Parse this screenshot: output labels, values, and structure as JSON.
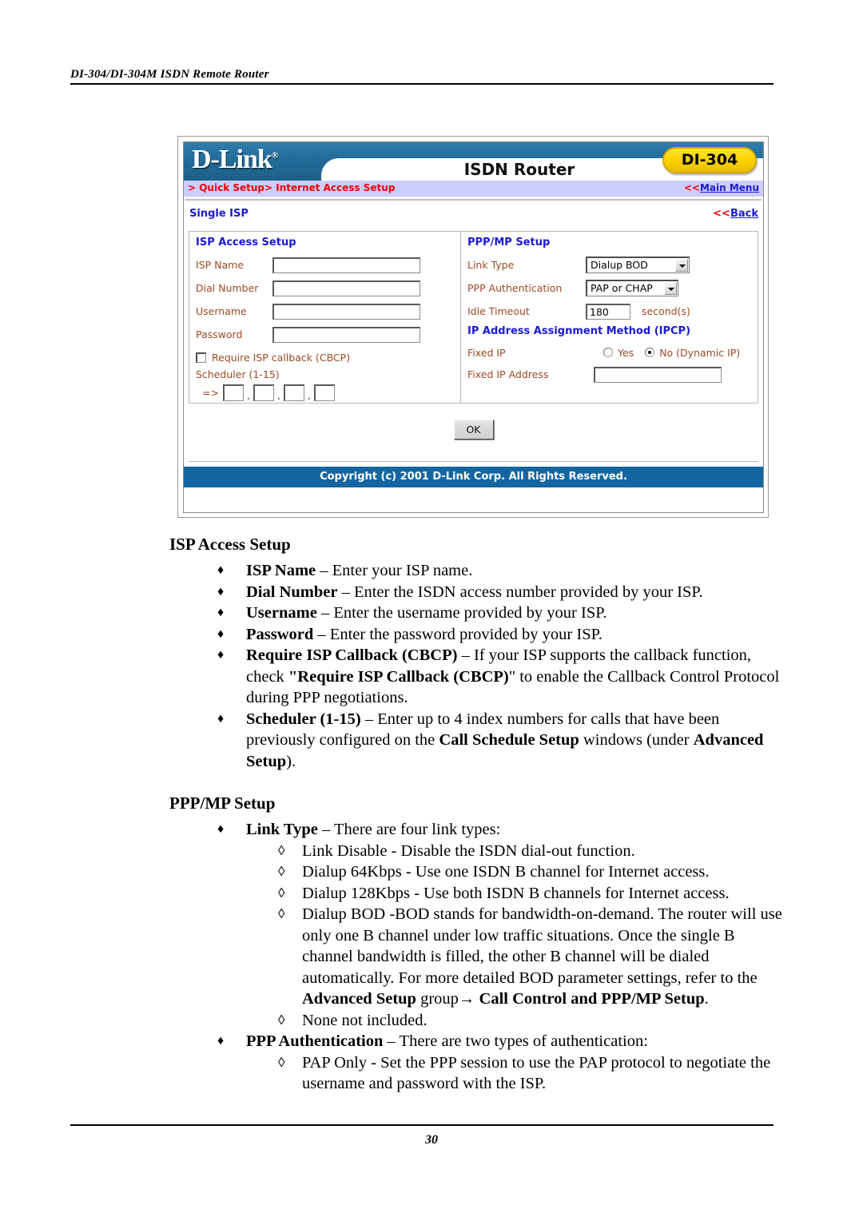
{
  "document": {
    "running_head": "DI-304/DI-304M ISDN Remote Router",
    "page_number": "30"
  },
  "router_ui": {
    "brand": {
      "logo_text": "D-Link",
      "logo_trademark": "®",
      "title": "ISDN Router",
      "model_badge": "DI-304"
    },
    "breadcrumb": {
      "path": "> Quick Setup> Internet Access Setup",
      "main_menu_arrows": "<<",
      "main_menu_label": "Main Menu"
    },
    "subheader": {
      "title": "Single ISP",
      "back_arrows": "<<",
      "back_label": "Back"
    },
    "isp_access_setup": {
      "group_title": "ISP Access Setup",
      "fields": [
        {
          "label": "ISP Name",
          "value": ""
        },
        {
          "label": "Dial Number",
          "value": ""
        },
        {
          "label": "Username",
          "value": ""
        },
        {
          "label": "Password",
          "value": ""
        }
      ],
      "callback_checkbox": {
        "label": "Require ISP callback (CBCP)",
        "checked": false
      },
      "scheduler": {
        "label": "Scheduler (1-15)",
        "arrow": "=>",
        "separator": ",",
        "values": [
          "",
          "",
          "",
          ""
        ]
      }
    },
    "ppp_mp_setup": {
      "group_title": "PPP/MP Setup",
      "link_type": {
        "label": "Link Type",
        "value": "Dialup BOD",
        "options": [
          "Link Disable",
          "Dialup 64Kbps",
          "Dialup 128Kbps",
          "Dialup BOD"
        ]
      },
      "ppp_authentication": {
        "label": "PPP Authentication",
        "value": "PAP or CHAP",
        "options": [
          "PAP Only",
          "PAP or CHAP"
        ]
      },
      "idle_timeout": {
        "label": "Idle Timeout",
        "value": "180",
        "units": "second(s)"
      },
      "ipcp": {
        "group_title": "IP Address Assignment Method (IPCP)",
        "fixed_ip": {
          "label": "Fixed IP",
          "yes_label": "Yes",
          "no_label": "No (Dynamic IP)",
          "selected": "No (Dynamic IP)"
        },
        "fixed_ip_address": {
          "label": "Fixed IP Address",
          "value": ""
        }
      }
    },
    "ok_button": "OK",
    "copyright": "Copyright (c) 2001 D-Link Corp. All Rights Reserved."
  },
  "body": {
    "section1_title": "ISP Access Setup",
    "section2_title": "PPP/MP Setup",
    "bullet_char": "♦",
    "diamond_char": "◊",
    "isp_bullets": {
      "b1_term": "ISP Name",
      "b1_text": " – Enter your ISP name.",
      "b2_term": "Dial Number",
      "b2_text": " – Enter the ISDN access number provided by your ISP.",
      "b3_term": "Username",
      "b3_text": " – Enter the username provided by your ISP.",
      "b4_term": "Password",
      "b4_text": " – Enter the password provided by your ISP.",
      "b5_term": "Require ISP Callback (CBCP)",
      "b5_text_a": " – If your ISP supports the callback function, check ",
      "b5_quoted": "\"Require ISP Callback (CBCP)",
      "b5_text_b": "\" to enable the Callback Control Protocol during PPP negotiations.",
      "b6_term": "Scheduler (1-15)",
      "b6_text_a": " – Enter up to 4 index numbers for calls that have been previously configured on the ",
      "b6_bold_a": "Call Schedule Setup",
      "b6_text_b": " windows (under ",
      "b6_bold_b": "Advanced Setup",
      "b6_text_c": ")."
    },
    "ppp_bullets": {
      "link_type_term": "Link Type",
      "link_type_text": " – There are four link types:",
      "lt_item1": "Link Disable - Disable the ISDN dial-out function.",
      "lt_item2": "Dialup 64Kbps - Use one ISDN B channel for Internet access.",
      "lt_item3": "Dialup 128Kbps - Use both ISDN B channels for Internet access.",
      "lt_item4_a": "Dialup BOD -BOD stands for bandwidth-on-demand. The router will use only one B channel under low traffic situations. Once the single B channel bandwidth is filled, the other B channel will be dialed automatically. For more detailed BOD parameter settings, refer to the ",
      "lt_item4_bold_a": "Advanced Setup",
      "lt_item4_b": " group",
      "lt_item4_arrow": "→",
      "lt_item4_bold_b": " Call Control and PPP/MP Setup",
      "lt_item4_c": ".",
      "lt_item5": "None not included.",
      "ppp_auth_term": "PPP Authentication",
      "ppp_auth_text": " – There are two types of authentication:",
      "pa_item1": "PAP Only - Set the PPP session to use the PAP protocol to negotiate the username and password with the ISP."
    }
  }
}
